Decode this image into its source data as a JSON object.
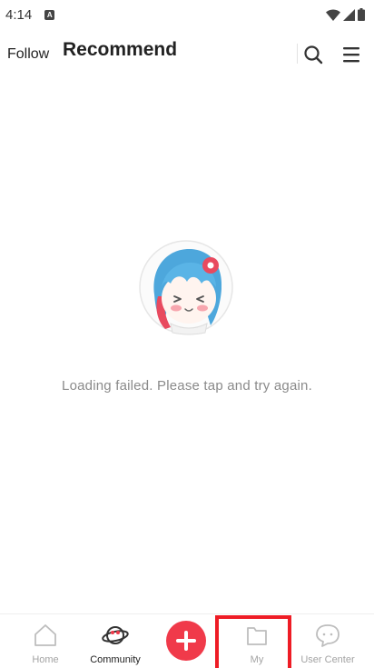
{
  "status_bar": {
    "time": "4:14",
    "app_badge": "A",
    "icons": [
      "wifi-icon",
      "signal-icon",
      "battery-icon"
    ]
  },
  "header": {
    "tabs": [
      {
        "label": "Follow",
        "active": false
      },
      {
        "label": "Recommend",
        "active": true
      }
    ],
    "icons": [
      "search-icon",
      "menu-icon"
    ]
  },
  "content": {
    "empty_state_icon": "mascot-illustration",
    "message": "Loading failed. Please tap and try again."
  },
  "bottom_nav": {
    "items": [
      {
        "label": "Home",
        "icon": "home-icon",
        "active": false
      },
      {
        "label": "Community",
        "icon": "planet-icon",
        "active": true
      },
      {
        "label": "",
        "icon": "plus-icon",
        "active": false
      },
      {
        "label": "My",
        "icon": "folder-icon",
        "active": false
      },
      {
        "label": "User Center",
        "icon": "chat-bubble-icon",
        "active": false
      }
    ]
  },
  "colors": {
    "accent": "#f03a4a",
    "highlight": "#ee1c25",
    "muted_text": "#8a8a8a"
  }
}
